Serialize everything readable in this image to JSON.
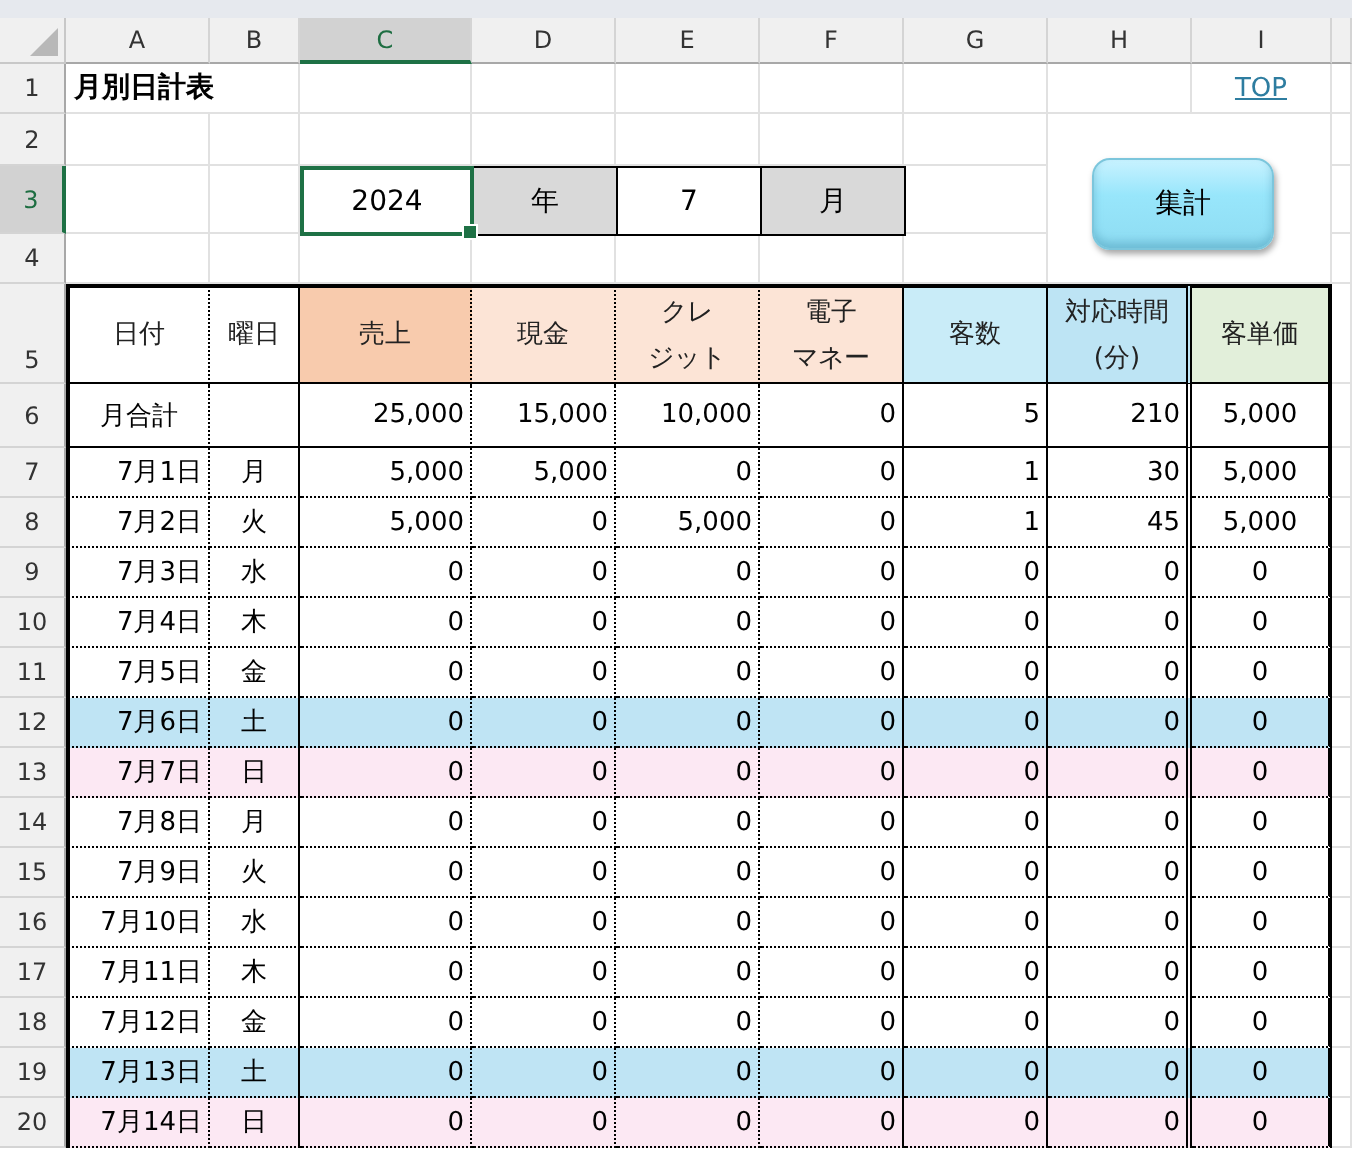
{
  "column_headers": [
    {
      "label": "A",
      "selected": false
    },
    {
      "label": "B",
      "selected": false
    },
    {
      "label": "C",
      "selected": true
    },
    {
      "label": "D",
      "selected": false
    },
    {
      "label": "E",
      "selected": false
    },
    {
      "label": "F",
      "selected": false
    },
    {
      "label": "G",
      "selected": false
    },
    {
      "label": "H",
      "selected": false
    },
    {
      "label": "I",
      "selected": false
    }
  ],
  "row_headers": [
    {
      "label": "1",
      "selected": false
    },
    {
      "label": "2",
      "selected": false
    },
    {
      "label": "3",
      "selected": true
    },
    {
      "label": "4",
      "selected": false
    },
    {
      "label": "5",
      "selected": false
    },
    {
      "label": "6",
      "selected": false
    },
    {
      "label": "7",
      "selected": false
    },
    {
      "label": "8",
      "selected": false
    },
    {
      "label": "9",
      "selected": false
    },
    {
      "label": "10",
      "selected": false
    },
    {
      "label": "11",
      "selected": false
    },
    {
      "label": "12",
      "selected": false
    },
    {
      "label": "13",
      "selected": false
    },
    {
      "label": "14",
      "selected": false
    },
    {
      "label": "15",
      "selected": false
    },
    {
      "label": "16",
      "selected": false
    },
    {
      "label": "17",
      "selected": false
    },
    {
      "label": "18",
      "selected": false
    },
    {
      "label": "19",
      "selected": false
    },
    {
      "label": "20",
      "selected": false
    }
  ],
  "title": "月別日計表",
  "top_link": "TOP",
  "year_cell": {
    "value": "2024",
    "selected": true
  },
  "year_label": "年",
  "month_cell": {
    "value": "7",
    "selected": false
  },
  "month_label": "月",
  "tally_button": "集計",
  "table": {
    "columns": [
      {
        "lines": [
          "日付"
        ],
        "color": "#ffffff"
      },
      {
        "lines": [
          "曜日"
        ],
        "color": "#ffffff"
      },
      {
        "lines": [
          "売上"
        ],
        "color": "#f8cbad"
      },
      {
        "lines": [
          "現金"
        ],
        "color": "#fce4d6"
      },
      {
        "lines": [
          "クレ",
          "ジット"
        ],
        "color": "#fce4d6"
      },
      {
        "lines": [
          "電子",
          "マネー"
        ],
        "color": "#fce4d6"
      },
      {
        "lines": [
          "客数"
        ],
        "color": "#c9ecf8"
      },
      {
        "lines": [
          "対応時間",
          "(分)"
        ],
        "color": "#bde4f4"
      },
      {
        "lines": [
          "客単価"
        ],
        "color": "#e2efda"
      }
    ],
    "total": {
      "label": "月合計",
      "values": [
        "25,000",
        "15,000",
        "10,000",
        "0",
        "5",
        "210",
        "5,000"
      ]
    },
    "rows": [
      {
        "date": "7月1日",
        "weekday": "月",
        "kind": "weekday",
        "values": [
          "5,000",
          "5,000",
          "0",
          "0",
          "1",
          "30",
          "5,000"
        ]
      },
      {
        "date": "7月2日",
        "weekday": "火",
        "kind": "weekday",
        "values": [
          "5,000",
          "0",
          "5,000",
          "0",
          "1",
          "45",
          "5,000"
        ]
      },
      {
        "date": "7月3日",
        "weekday": "水",
        "kind": "weekday",
        "values": [
          "0",
          "0",
          "0",
          "0",
          "0",
          "0",
          "0"
        ]
      },
      {
        "date": "7月4日",
        "weekday": "木",
        "kind": "weekday",
        "values": [
          "0",
          "0",
          "0",
          "0",
          "0",
          "0",
          "0"
        ]
      },
      {
        "date": "7月5日",
        "weekday": "金",
        "kind": "weekday",
        "values": [
          "0",
          "0",
          "0",
          "0",
          "0",
          "0",
          "0"
        ]
      },
      {
        "date": "7月6日",
        "weekday": "土",
        "kind": "saturday",
        "values": [
          "0",
          "0",
          "0",
          "0",
          "0",
          "0",
          "0"
        ]
      },
      {
        "date": "7月7日",
        "weekday": "日",
        "kind": "sunday",
        "values": [
          "0",
          "0",
          "0",
          "0",
          "0",
          "0",
          "0"
        ]
      },
      {
        "date": "7月8日",
        "weekday": "月",
        "kind": "weekday",
        "values": [
          "0",
          "0",
          "0",
          "0",
          "0",
          "0",
          "0"
        ]
      },
      {
        "date": "7月9日",
        "weekday": "火",
        "kind": "weekday",
        "values": [
          "0",
          "0",
          "0",
          "0",
          "0",
          "0",
          "0"
        ]
      },
      {
        "date": "7月10日",
        "weekday": "水",
        "kind": "weekday",
        "values": [
          "0",
          "0",
          "0",
          "0",
          "0",
          "0",
          "0"
        ]
      },
      {
        "date": "7月11日",
        "weekday": "木",
        "kind": "weekday",
        "values": [
          "0",
          "0",
          "0",
          "0",
          "0",
          "0",
          "0"
        ]
      },
      {
        "date": "7月12日",
        "weekday": "金",
        "kind": "weekday",
        "values": [
          "0",
          "0",
          "0",
          "0",
          "0",
          "0",
          "0"
        ]
      },
      {
        "date": "7月13日",
        "weekday": "土",
        "kind": "saturday",
        "values": [
          "0",
          "0",
          "0",
          "0",
          "0",
          "0",
          "0"
        ]
      },
      {
        "date": "7月14日",
        "weekday": "日",
        "kind": "sunday",
        "values": [
          "0",
          "0",
          "0",
          "0",
          "0",
          "0",
          "0"
        ]
      }
    ]
  }
}
